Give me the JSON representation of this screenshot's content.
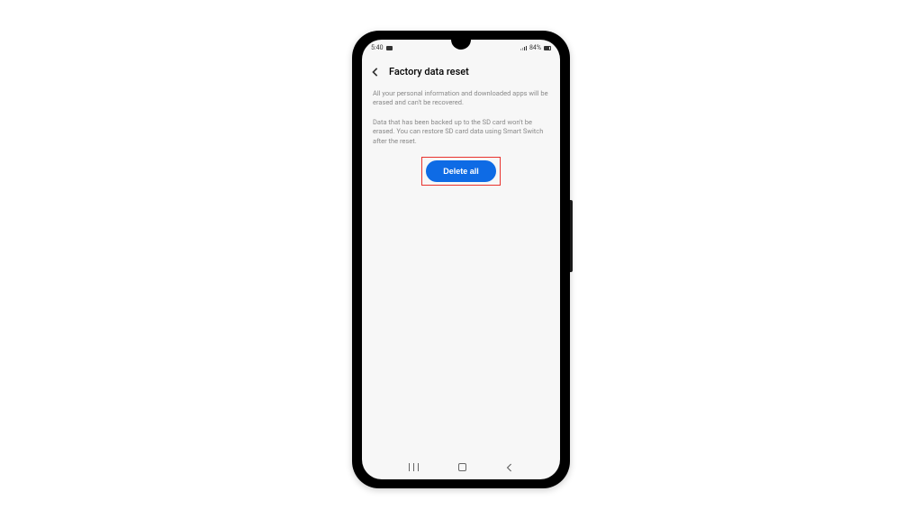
{
  "status_bar": {
    "time": "5:40",
    "battery_text": "84%"
  },
  "header": {
    "title": "Factory data reset"
  },
  "content": {
    "paragraph1": "All your personal information and downloaded apps will be erased and can't be recovered.",
    "paragraph2": "Data that has been backed up to the SD card won't be erased. You can restore SD card data using Smart Switch after the reset."
  },
  "button": {
    "delete_all": "Delete all"
  }
}
